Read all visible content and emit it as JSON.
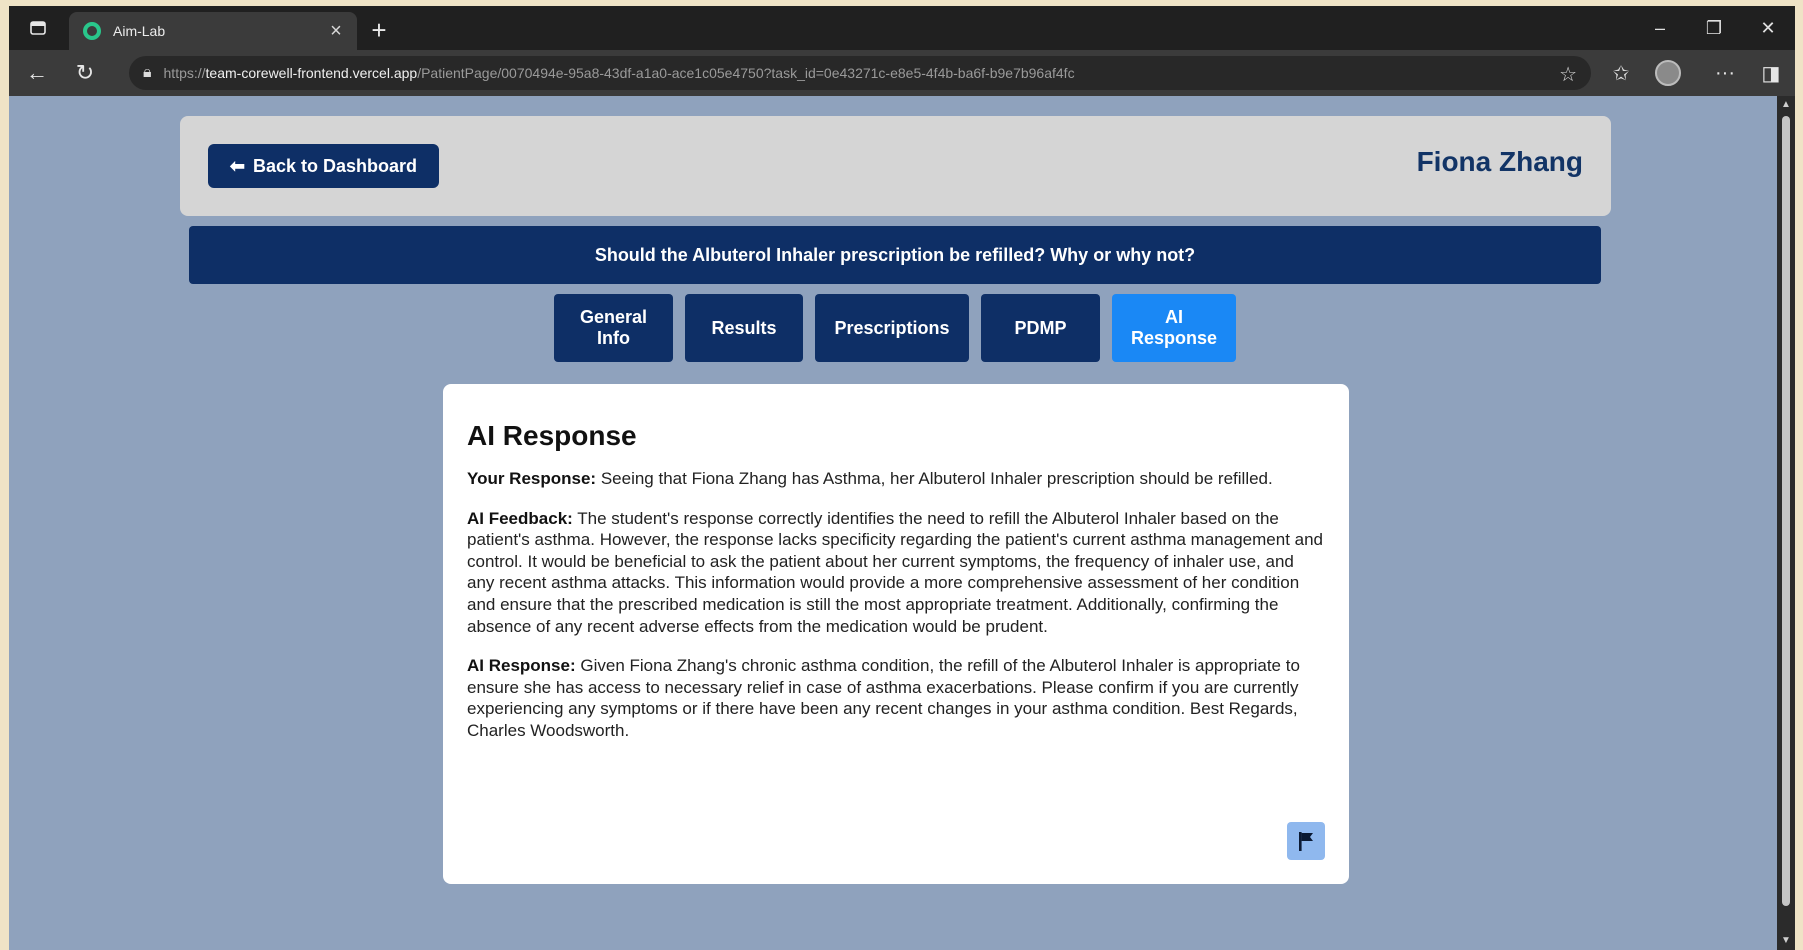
{
  "browser": {
    "tab_title": "Aim-Lab",
    "url_prefix": "https://",
    "url_host": "team-corewell-frontend.vercel.app",
    "url_path": "/PatientPage/0070494e-95a8-43df-a1a0-ace1c05e4750?task_id=0e43271c-e8e5-4f4b-ba6f-b9e7b96af4fc"
  },
  "header": {
    "back_label": "Back to Dashboard",
    "patient_name": "Fiona Zhang"
  },
  "question": "Should the Albuterol Inhaler prescription be refilled? Why or why not?",
  "tabs": [
    {
      "line1": "General",
      "line2": "Info"
    },
    {
      "line1": "Results",
      "line2": ""
    },
    {
      "line1": "Prescriptions",
      "line2": ""
    },
    {
      "line1": "PDMP",
      "line2": ""
    },
    {
      "line1": "AI",
      "line2": "Response"
    }
  ],
  "active_tab": "AI Response",
  "card": {
    "title": "AI Response",
    "your_response_label": "Your Response:",
    "your_response_text": "Seeing that Fiona Zhang has Asthma, her Albuterol Inhaler prescription should be refilled.",
    "feedback_label": "AI Feedback:",
    "feedback_text": "The student's response correctly identifies the need to refill the Albuterol Inhaler based on the patient's asthma. However, the response lacks specificity regarding the patient's current asthma management and control. It would be beneficial to ask the patient about her current symptoms, the frequency of inhaler use, and any recent asthma attacks. This information would provide a more comprehensive assessment of her condition and ensure that the prescribed medication is still the most appropriate treatment. Additionally, confirming the absence of any recent adverse effects from the medication would be prudent.",
    "ai_response_label": "AI Response:",
    "ai_response_text": "Given Fiona Zhang's chronic asthma condition, the refill of the Albuterol Inhaler is appropriate to ensure she has access to necessary relief in case of asthma exacerbations. Please confirm if you are currently experiencing any symptoms or if there have been any recent changes in your asthma condition. Best Regards, Charles Woodsworth."
  },
  "colors": {
    "page_bg": "#8fa2bd",
    "navy": "#0e2f66",
    "active_tab": "#1a88f5",
    "flag_btn": "#8fb8ee"
  }
}
